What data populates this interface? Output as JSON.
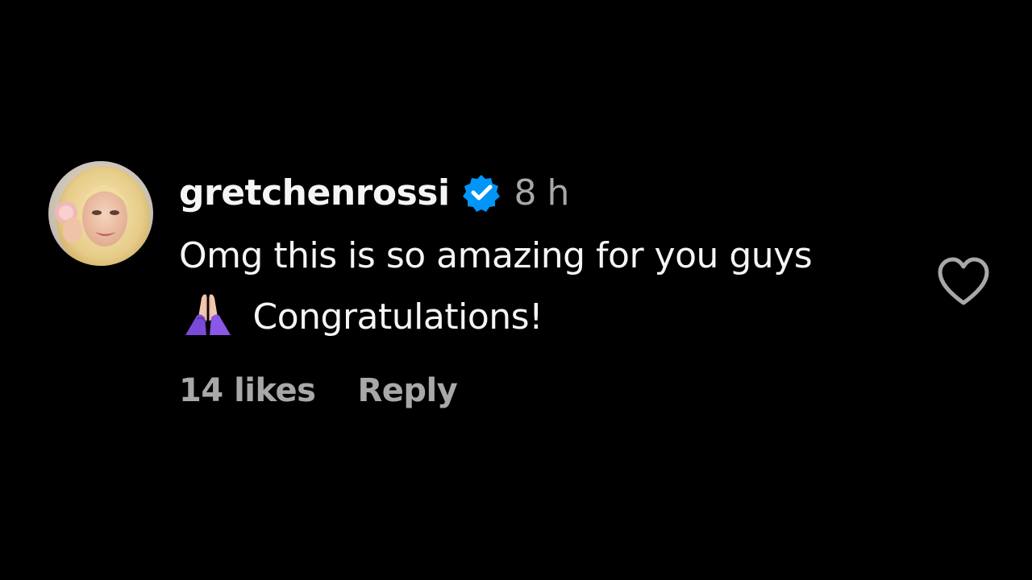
{
  "comment": {
    "avatar_icon": "profile-photo-blonde-woman",
    "username": "gretchenrossi",
    "verified_icon": "verified-badge-icon",
    "time_ago": "8 h",
    "text_before_emoji": "Omg this is so amazing for you guys",
    "emoji_icon": "folded-hands-emoji",
    "text_after_emoji": "Congratulations!",
    "likes_label": "14 likes",
    "reply_label": "Reply",
    "like_icon": "heart-outline-icon"
  },
  "colors": {
    "background": "#000000",
    "primary_text": "#f5f5f5",
    "secondary_text": "#a8a8a8",
    "verified_blue": "#0095f6"
  }
}
